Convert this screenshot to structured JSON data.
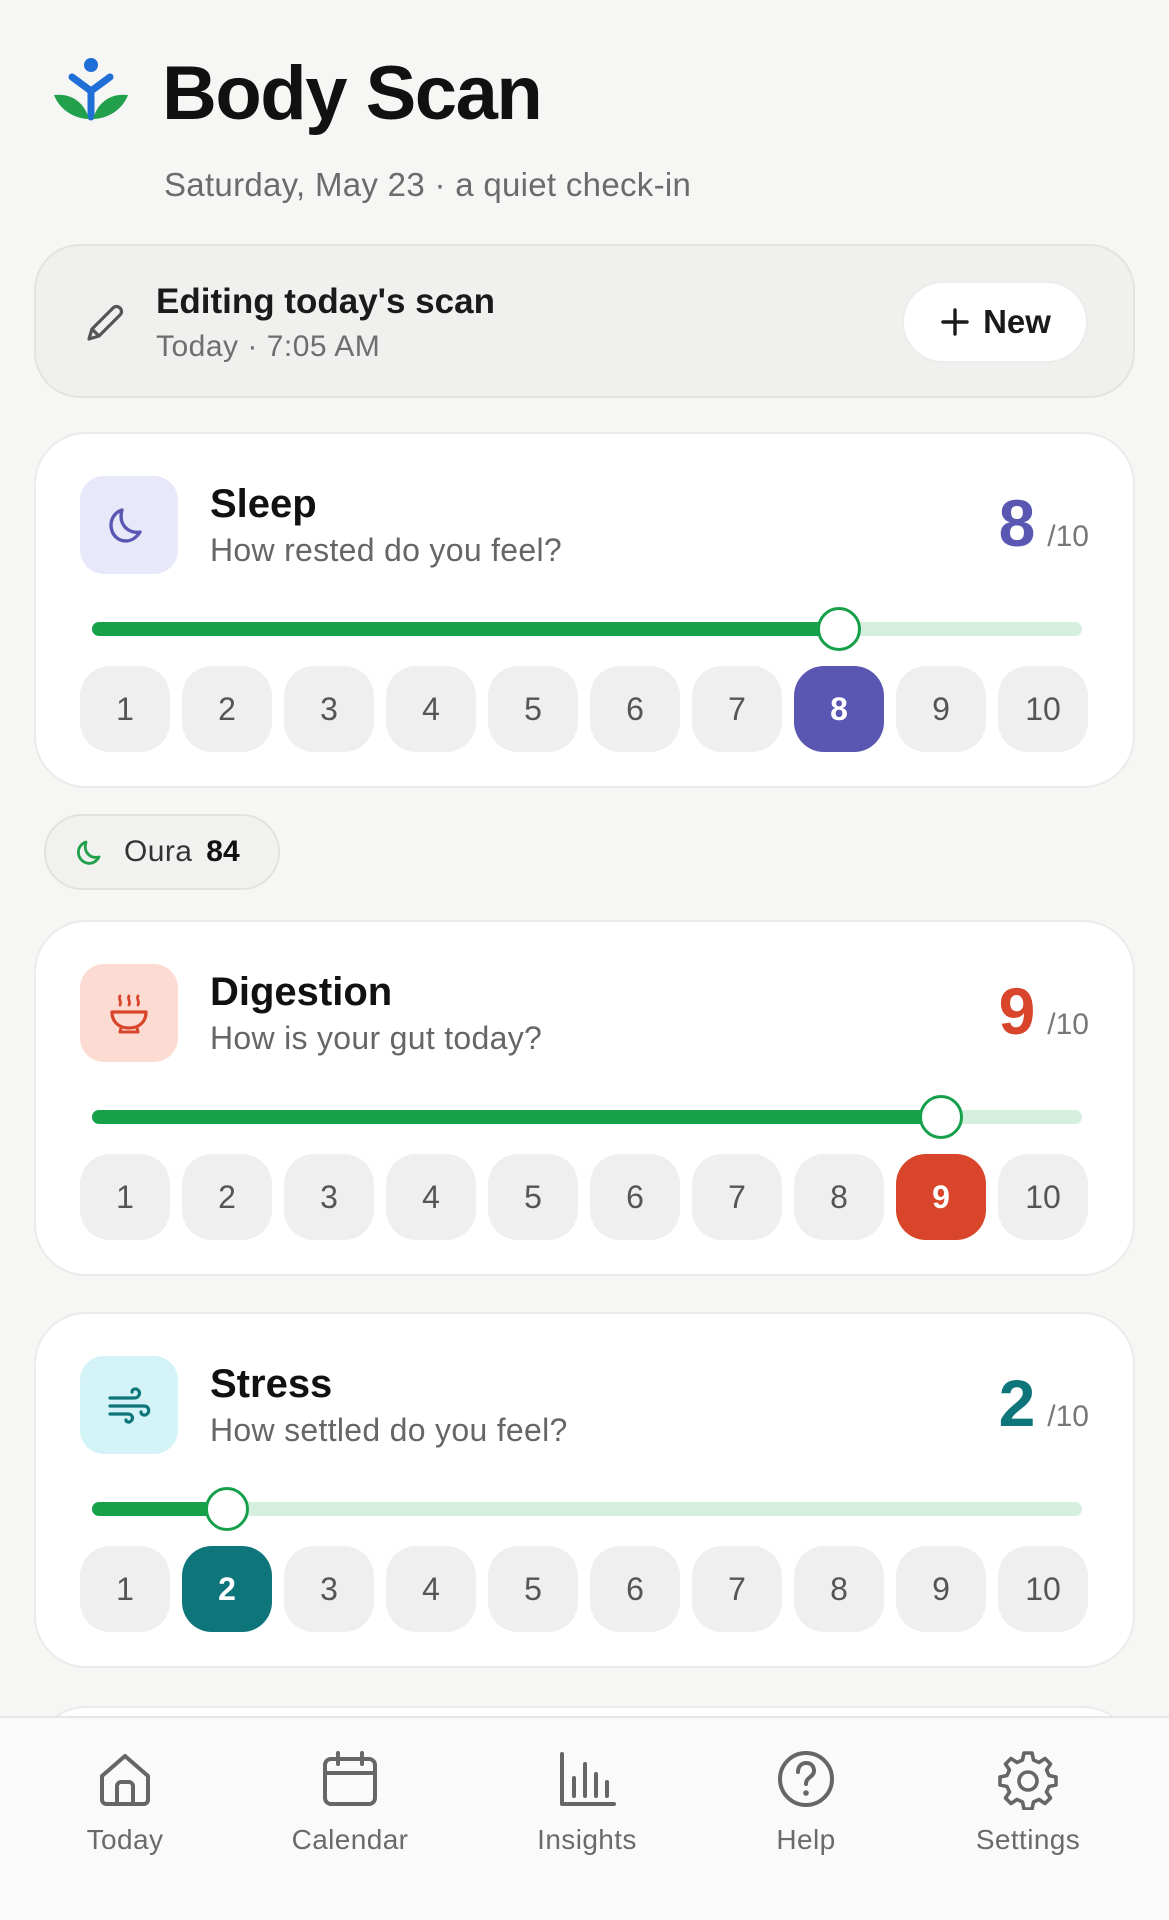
{
  "header": {
    "title": "Body Scan",
    "subtitle": "Saturday, May 23 · a quiet check-in"
  },
  "edit_banner": {
    "title": "Editing today's scan",
    "time": "Today · 7:05 AM",
    "new_label": "New"
  },
  "colors": {
    "sleep": "#5a57b3",
    "digestion": "#d8452a",
    "stress": "#0e767a",
    "slider_fill": "#16a04a"
  },
  "cards": [
    {
      "title": "Sleep",
      "question": "How rested do you feel?",
      "icon": "moon-icon",
      "value": "8",
      "max": "/10",
      "level": 8
    },
    {
      "title": "Digestion",
      "question": "How is your gut today?",
      "icon": "bowl-icon",
      "value": "9",
      "max": "/10",
      "level": 9
    },
    {
      "title": "Stress",
      "question": "How settled do you feel?",
      "icon": "wind-icon",
      "value": "2",
      "max": "/10",
      "level": 2
    }
  ],
  "scale": [
    "1",
    "2",
    "3",
    "4",
    "5",
    "6",
    "7",
    "8",
    "9",
    "10"
  ],
  "oura": {
    "label": "Oura",
    "value": "84"
  },
  "nav": {
    "today": "Today",
    "calendar": "Calendar",
    "insights": "Insights",
    "help": "Help",
    "settings": "Settings"
  }
}
